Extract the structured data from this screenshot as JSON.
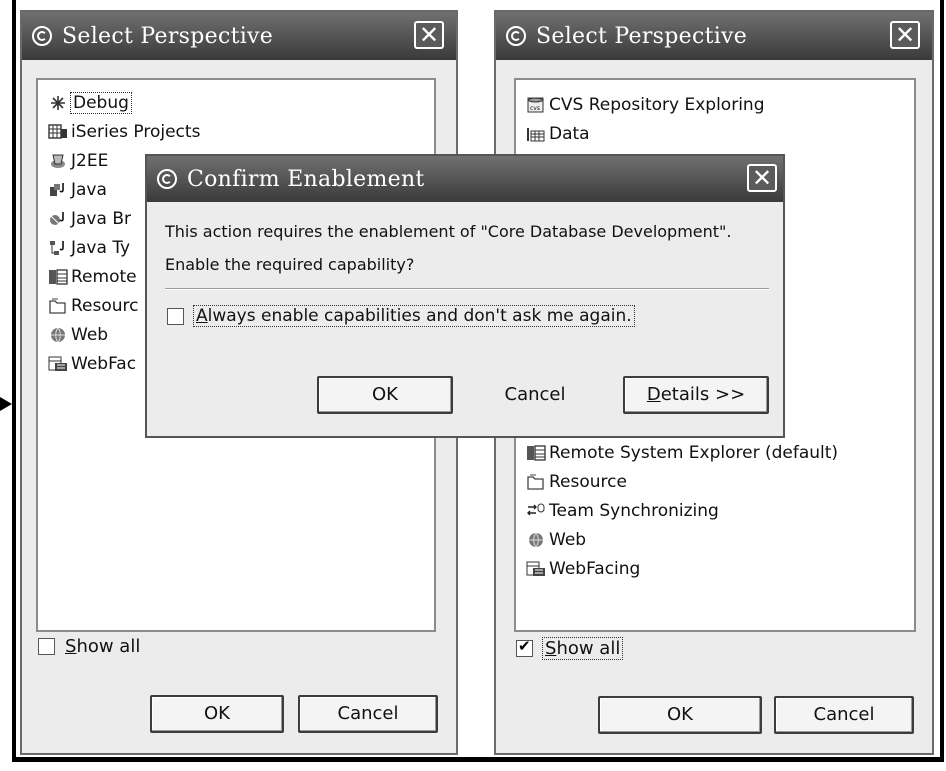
{
  "left_dialog": {
    "title": "Select Perspective",
    "items": [
      {
        "label": "Debug",
        "icon": "debug-icon"
      },
      {
        "label": "iSeries Projects",
        "icon": "iseries-projects-icon"
      },
      {
        "label": "J2EE",
        "icon": "j2ee-icon"
      },
      {
        "label": "Java",
        "icon": "java-icon"
      },
      {
        "label": "Java Br",
        "icon": "java-browsing-icon"
      },
      {
        "label": "Java Ty",
        "icon": "java-type-hierarchy-icon"
      },
      {
        "label": "Remote",
        "icon": "remote-system-explorer-icon"
      },
      {
        "label": "Resourc",
        "icon": "resource-icon"
      },
      {
        "label": "Web",
        "icon": "web-icon"
      },
      {
        "label": "WebFac",
        "icon": "webfacing-icon"
      }
    ],
    "show_all": {
      "prefix": "",
      "underlined": "S",
      "rest": "how all",
      "checked": false
    },
    "ok_label": "OK",
    "cancel_label": "Cancel"
  },
  "right_dialog": {
    "title": "Select Perspective",
    "items_top": [
      {
        "label": "CVS Repository Exploring",
        "icon": "cvs-repository-icon"
      },
      {
        "label": "Data",
        "icon": "data-icon"
      }
    ],
    "items_bottom": [
      {
        "label": "Remote System Explorer (default)",
        "icon": "remote-system-explorer-icon"
      },
      {
        "label": "Resource",
        "icon": "resource-icon"
      },
      {
        "label": "Team Synchronizing",
        "icon": "team-synchronizing-icon"
      },
      {
        "label": "Web",
        "icon": "web-icon"
      },
      {
        "label": "WebFacing",
        "icon": "webfacing-icon"
      }
    ],
    "show_all": {
      "prefix": "",
      "underlined": "S",
      "rest": "how all",
      "checked": true
    },
    "ok_label": "OK",
    "cancel_label": "Cancel"
  },
  "confirm_dialog": {
    "title": "Confirm Enablement",
    "message_line1": "This action requires the enablement of \"Core Database Development\".",
    "message_line2": "Enable the required capability?",
    "checkbox": {
      "underlined": "A",
      "rest": "lways enable capabilities and don't ask me again.",
      "checked": false
    },
    "ok_label": "OK",
    "cancel_label": "Cancel",
    "details_underlined": "D",
    "details_rest": "etails >>"
  },
  "colors": {
    "titlebar": "#4a4a4a",
    "dialog_bg": "#ececec",
    "list_bg": "#ffffff"
  }
}
